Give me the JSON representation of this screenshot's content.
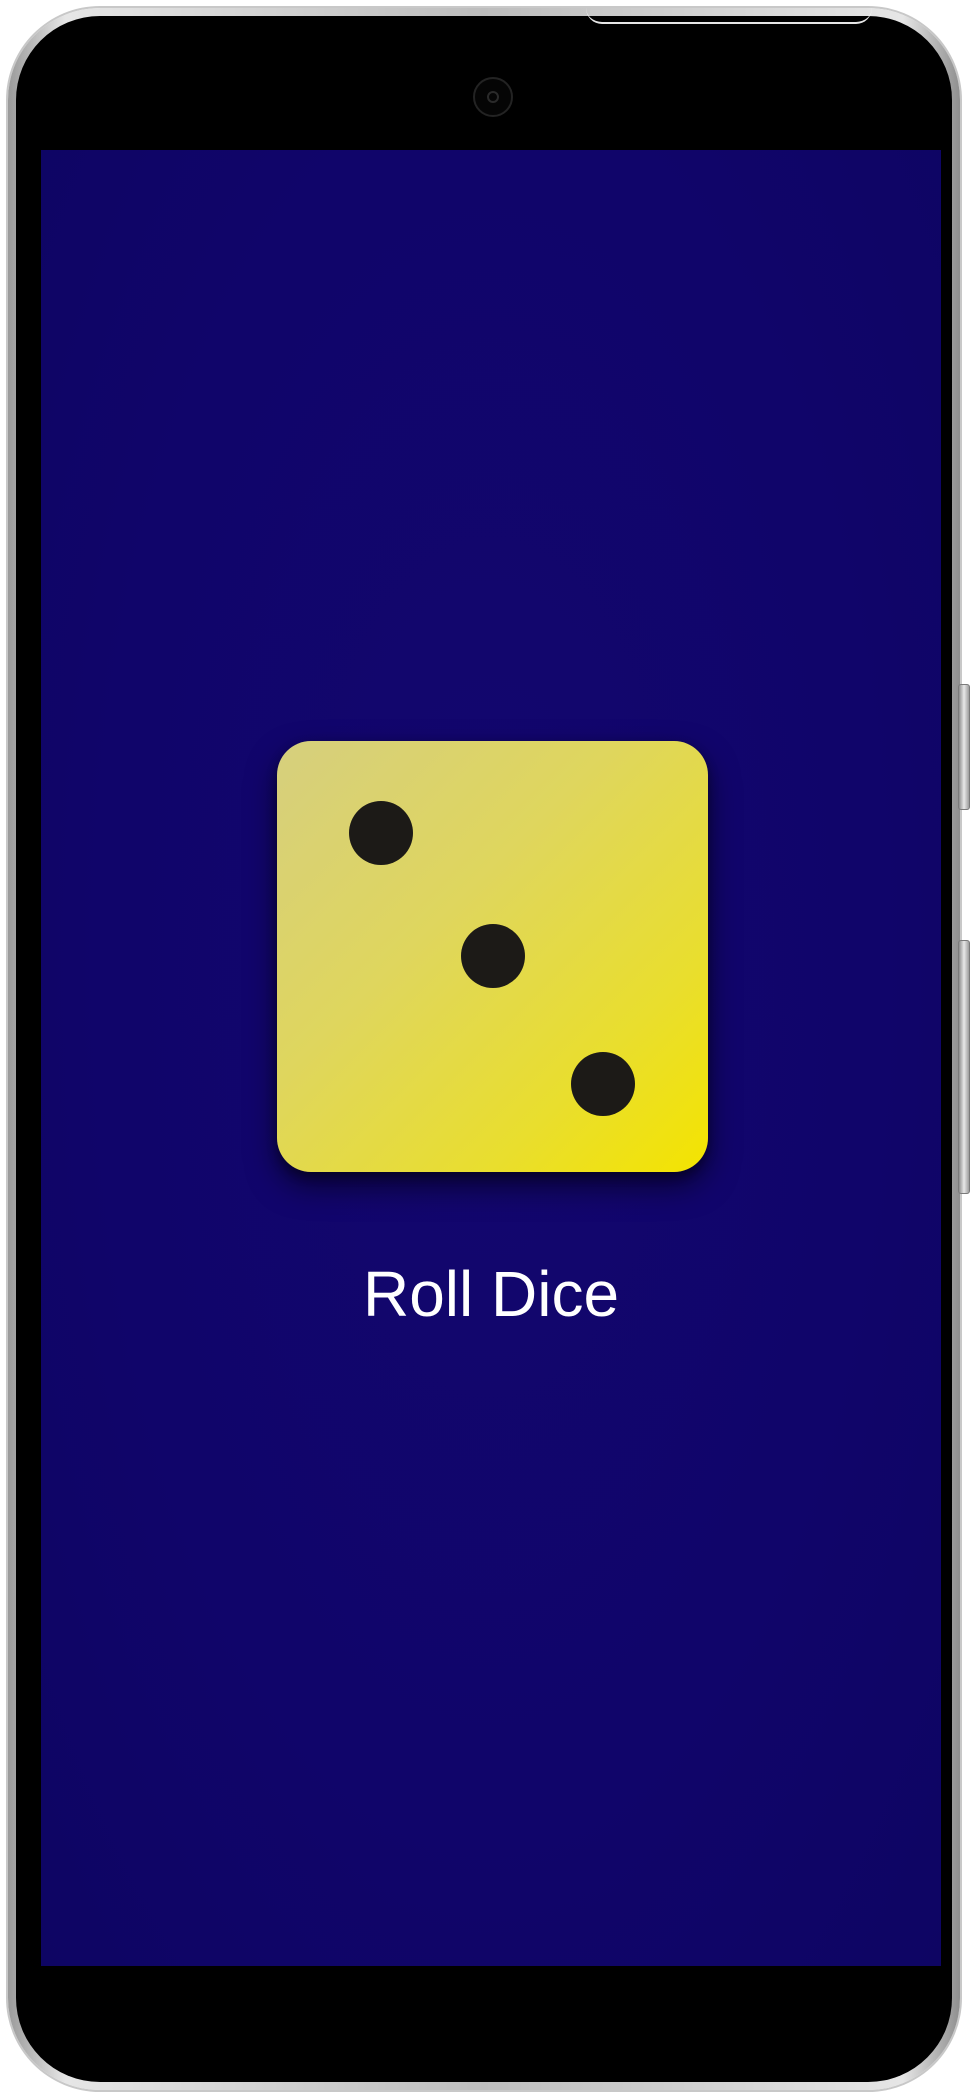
{
  "app": {
    "background_color": "#10056a",
    "button_label": "Roll Dice"
  },
  "dice": {
    "value": 3,
    "face_color": "#e6dc3a",
    "pip_color": "#1c1a17"
  },
  "device": {
    "camera_icon": "front-camera-icon"
  }
}
